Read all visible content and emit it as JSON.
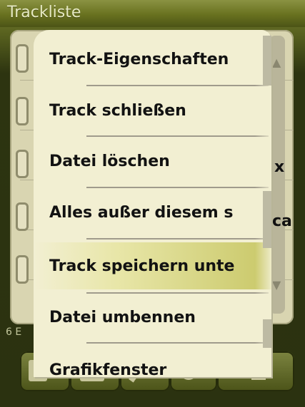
{
  "window": {
    "title": "Trackliste"
  },
  "background_list": {
    "count_label": "6 E",
    "peek_text_1": "x",
    "peek_text_2": "ca"
  },
  "context_menu": {
    "items": [
      {
        "label": "Track-Eigenschaften",
        "highlighted": false
      },
      {
        "label": "Track schließen",
        "highlighted": false
      },
      {
        "label": "Datei löschen",
        "highlighted": false
      },
      {
        "label": "Alles außer diesem s",
        "highlighted": false
      },
      {
        "label": "Track speichern unte",
        "highlighted": true
      },
      {
        "label": "Datei umbennen",
        "highlighted": false
      },
      {
        "label": "Grafikfenster",
        "highlighted": false
      }
    ]
  },
  "icons": {
    "toolbar": [
      "document-icon",
      "folder-icon",
      "pencil-icon",
      "tools-icon",
      "menu-icon"
    ]
  },
  "colors": {
    "title_bar": "#68711f",
    "menu_background": "#f2efd2",
    "highlight": "#c9c868"
  }
}
